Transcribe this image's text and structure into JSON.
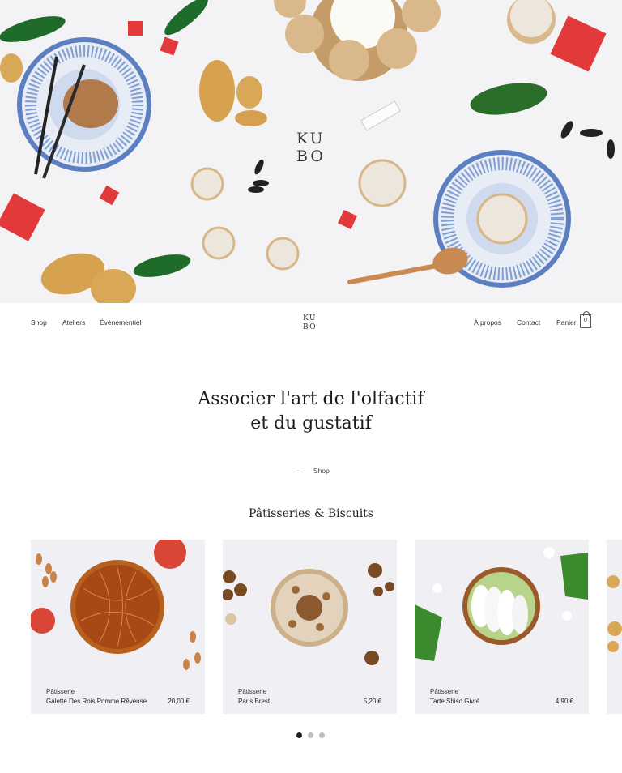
{
  "hero": {
    "logo_line1": "KU",
    "logo_line2": "BO"
  },
  "nav": {
    "left": [
      "Shop",
      "Ateliers",
      "Évènementiel"
    ],
    "logo_line1": "KU",
    "logo_line2": "BO",
    "right": [
      "À propos",
      "Contact",
      "Panier"
    ],
    "cart_count": "0"
  },
  "headline": {
    "line1": "Associer l'art de l'olfactif",
    "line2": "et du gustatif"
  },
  "shop_label": "Shop",
  "section_title": "Pâtisseries & Biscuits",
  "products": [
    {
      "category": "Pâtisserie",
      "name": "Galette Des Rois Pomme Rêveuse",
      "price": "20,00 €"
    },
    {
      "category": "Pâtisserie",
      "name": "Paris Brest",
      "price": "5,20 €"
    },
    {
      "category": "Pâtisserie",
      "name": "Tarte Shiso Givré",
      "price": "4,90 €"
    }
  ],
  "carousel": {
    "pages": 3,
    "active": 1
  },
  "colors": {
    "accent_red": "#e23a3a",
    "plate_blue": "#5b7fc0",
    "card_bg": "#f0eff4",
    "leaf_green": "#1f6b2a"
  }
}
